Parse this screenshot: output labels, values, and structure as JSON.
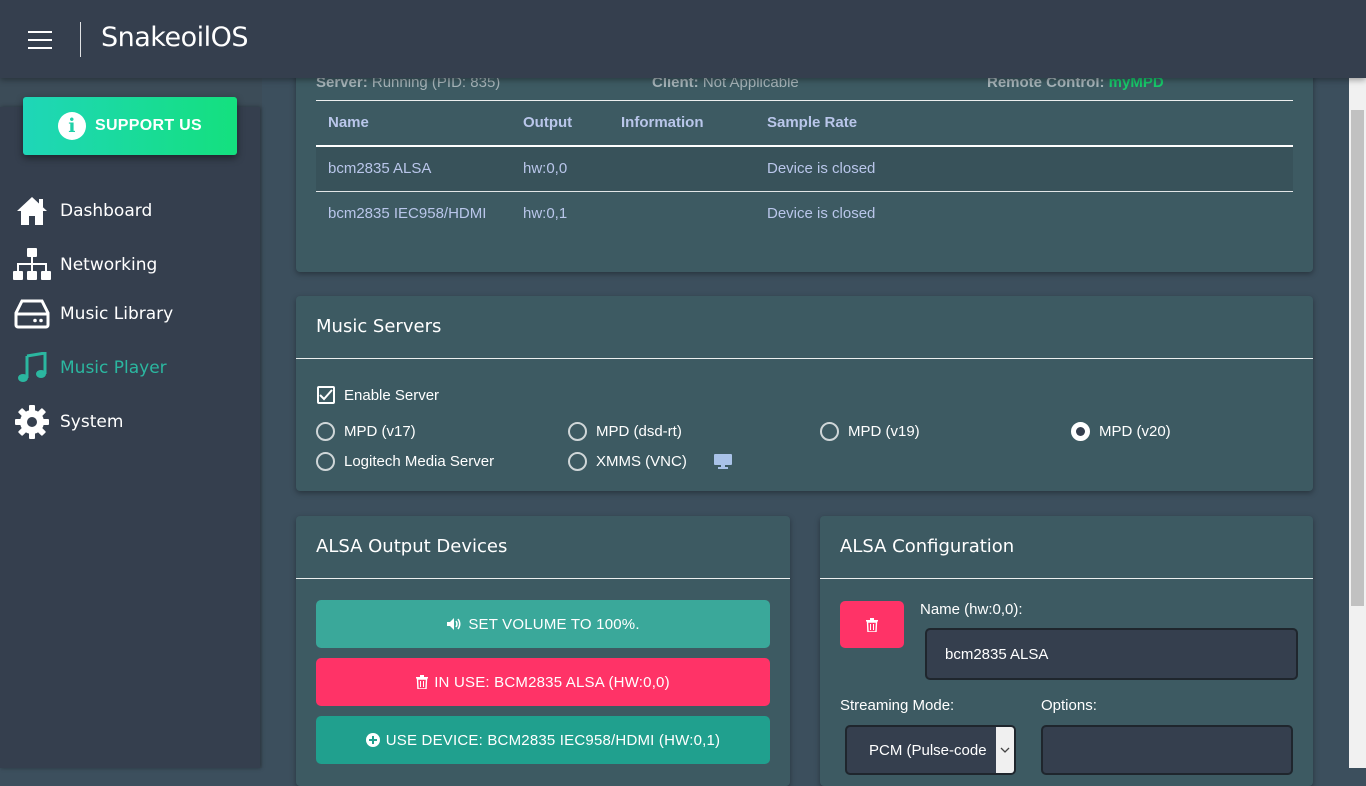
{
  "app": {
    "title": "SnakeoilOS"
  },
  "support": {
    "label": "SUPPORT US"
  },
  "sidebar": {
    "items": [
      {
        "label": "Dashboard",
        "icon": "home-icon"
      },
      {
        "label": "Networking",
        "icon": "network-icon"
      },
      {
        "label": "Music Library",
        "icon": "hard-drive-icon"
      },
      {
        "label": "Music Player",
        "icon": "music-note-icon",
        "active": true
      },
      {
        "label": "System",
        "icon": "gear-icon"
      }
    ]
  },
  "status": {
    "server_label": "Server:",
    "server_value": "Running (PID: 835)",
    "client_label": "Client:",
    "client_value": "Not Applicable",
    "remote_label": "Remote Control:",
    "remote_value": "myMPD"
  },
  "outputs_table": {
    "headers": [
      "Name",
      "Output",
      "Information",
      "Sample Rate"
    ],
    "rows": [
      {
        "name": "bcm2835 ALSA",
        "output": "hw:0,0",
        "information": "",
        "sample_rate": "Device is closed"
      },
      {
        "name": "bcm2835 IEC958/HDMI",
        "output": "hw:0,1",
        "information": "",
        "sample_rate": "Device is closed"
      }
    ]
  },
  "music_servers": {
    "title": "Music Servers",
    "enable_label": "Enable Server",
    "enabled": true,
    "options": [
      {
        "label": "MPD (v17)",
        "selected": false
      },
      {
        "label": "MPD (dsd-rt)",
        "selected": false
      },
      {
        "label": "MPD (v19)",
        "selected": false
      },
      {
        "label": "MPD (v20)",
        "selected": true
      },
      {
        "label": "Logitech Media Server",
        "selected": false
      },
      {
        "label": "XMMS (VNC)",
        "selected": false
      }
    ]
  },
  "alsa_output": {
    "title": "ALSA Output Devices",
    "set_volume_label": "SET VOLUME TO 100%.",
    "in_use_label": "IN USE: BCM2835 ALSA (HW:0,0)",
    "use_device_label": "USE DEVICE: BCM2835 IEC958/HDMI (HW:0,1)"
  },
  "alsa_config": {
    "title": "ALSA Configuration",
    "name_label": "Name (hw:0,0):",
    "name_value": "bcm2835 ALSA",
    "streaming_label": "Streaming Mode:",
    "streaming_value": "PCM (Pulse-code modulation)",
    "options_label": "Options:",
    "options_value": ""
  },
  "colors": {
    "header": "#353f4e",
    "card": "#3d5a62",
    "teal": "#3aa89a",
    "teal_dark": "#20a08e",
    "pink": "#ff3367",
    "green": "#17c96a"
  }
}
